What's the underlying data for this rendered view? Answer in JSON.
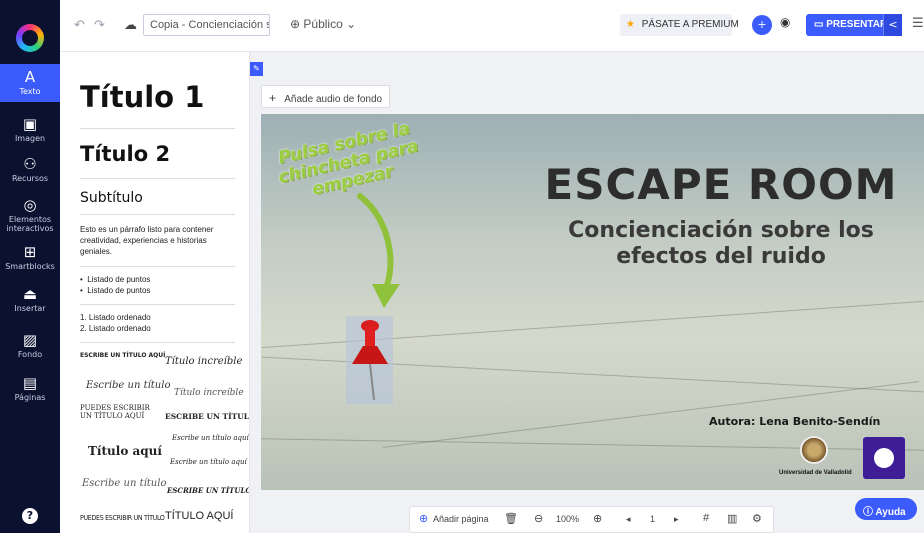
{
  "rail": {
    "items": [
      {
        "label": "Texto",
        "icon": "text-icon",
        "glyph": "A"
      },
      {
        "label": "Imagen",
        "icon": "image-icon",
        "glyph": "▣"
      },
      {
        "label": "Recursos",
        "icon": "resources-icon",
        "glyph": "⚇"
      },
      {
        "label": "Elementos interactivos",
        "icon": "interactive-icon",
        "glyph": "◎"
      },
      {
        "label": "Smartblocks",
        "icon": "smartblocks-icon",
        "glyph": "⊞"
      },
      {
        "label": "Insertar",
        "icon": "insert-icon",
        "glyph": "⏏"
      },
      {
        "label": "Fondo",
        "icon": "background-icon",
        "glyph": "▨"
      },
      {
        "label": "Páginas",
        "icon": "pages-icon",
        "glyph": "▤"
      }
    ],
    "help_glyph": "?"
  },
  "topbar": {
    "title": "Copia - Concienciación sob...",
    "visibility": "Público",
    "premium": "PÁSATE A PREMIUM",
    "present": "PRESENTAR"
  },
  "panel": {
    "h1": "Título 1",
    "h2": "Título 2",
    "subtitle": "Subtítulo",
    "paragraph": "Esto es un párrafo listo para contener creatividad, experiencias e historias geniales.",
    "bullets": [
      "Listado de puntos",
      "Listado de puntos"
    ],
    "ordered": [
      "1.  Listado ordenado",
      "2.  Listado ordenado"
    ],
    "templates": {
      "t1": "ESCRIBE UN TÍTULO AQUÍ",
      "t2": "Título increíble",
      "t3": "Escribe un título",
      "t4": "Título increíble",
      "t5": "PUEDES ESCRIBIR UN TÍTULO AQUÍ",
      "t6": "ESCRIBE UN TÍTULO",
      "t7": "Escribe un título aquí",
      "t8": "Título aquí",
      "t9": "Escribe un título aquí",
      "t10": "Escribe un título",
      "t11": "ESCRIBE UN TÍTULO",
      "t12": "PUEDES ESCRIBIR UN TÍTULO",
      "t13": "TÍTULO AQUÍ"
    }
  },
  "editor": {
    "audio": "Añade audio de fondo",
    "help": "Ayuda"
  },
  "slide": {
    "instruction": "Pulsa sobre la chincheta para empezar",
    "title": "ESCAPE ROOM",
    "subtitle": "Concienciación sobre los efectos del ruido",
    "author": "Autora: Lena Benito-Sendín",
    "university": "Universidad de Valladolid"
  },
  "bottombar": {
    "add_page": "Añadir página",
    "zoom": "100%",
    "page": "1"
  }
}
